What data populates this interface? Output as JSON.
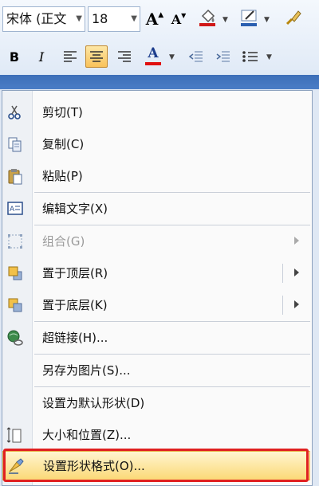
{
  "toolbar": {
    "font_name": "宋体 (正文",
    "font_size": "18",
    "grow_font_glyph": "A",
    "shrink_font_glyph": "A",
    "bold_glyph": "B",
    "italic_glyph": "I",
    "font_color_glyph": "A",
    "font_color": "#e01010",
    "fill_color": "#d01818",
    "line_color": "#2a5fb0"
  },
  "menu": {
    "items": [
      {
        "label": "剪切(T)",
        "icon": "scissors-icon"
      },
      {
        "label": "复制(C)",
        "icon": "copy-icon"
      },
      {
        "label": "粘贴(P)",
        "icon": "paste-icon"
      },
      {
        "label": "编辑文字(X)",
        "icon": "edit-text-icon"
      },
      {
        "label": "组合(G)",
        "icon": "group-icon",
        "disabled": true,
        "submenu": true
      },
      {
        "label": "置于顶层(R)",
        "icon": "bring-to-front-icon",
        "submenu": true
      },
      {
        "label": "置于底层(K)",
        "icon": "send-to-back-icon",
        "submenu": true
      },
      {
        "label": "超链接(H)...",
        "icon": "hyperlink-icon"
      },
      {
        "label": "另存为图片(S)...",
        "icon": ""
      },
      {
        "label": "设置为默认形状(D)",
        "icon": ""
      },
      {
        "label": "大小和位置(Z)...",
        "icon": "size-position-icon"
      },
      {
        "label": "设置形状格式(O)...",
        "icon": "format-shape-icon",
        "highlighted": true
      }
    ]
  }
}
